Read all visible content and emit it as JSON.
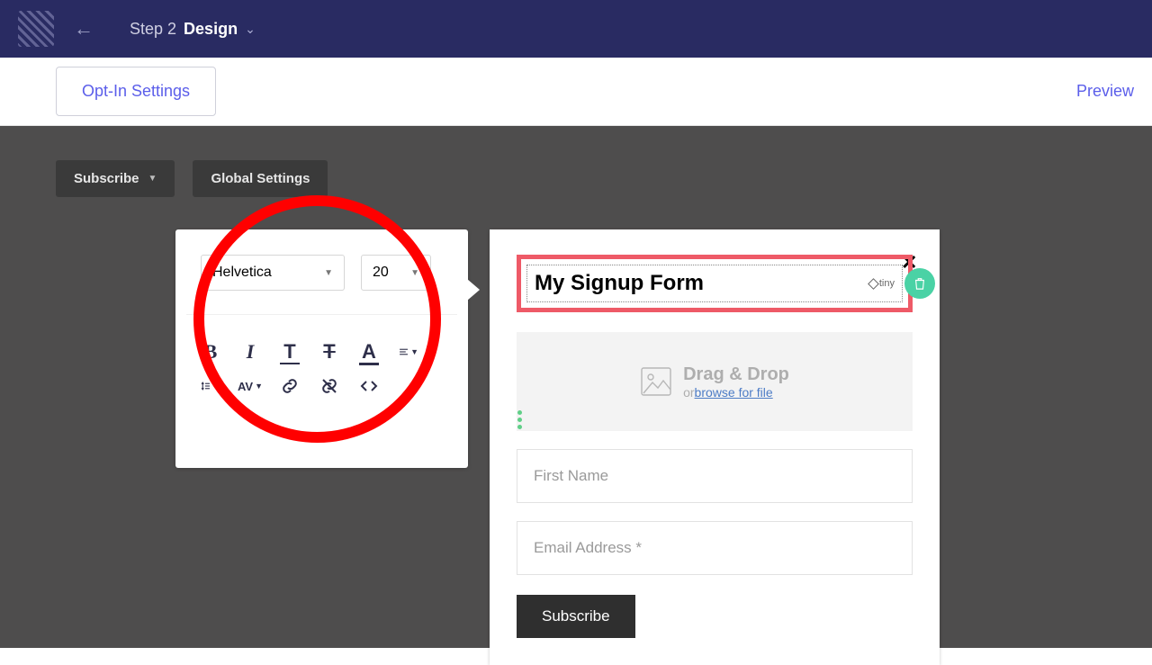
{
  "header": {
    "step_prefix": "Step 2",
    "step_name": "Design"
  },
  "subnav": {
    "optin_label": "Opt-In Settings",
    "preview_label": "Preview"
  },
  "tabs": {
    "subscribe": "Subscribe",
    "global": "Global Settings"
  },
  "toolbar": {
    "font": "Helvetica",
    "size": "20"
  },
  "form": {
    "title": "My Signup Form",
    "tiny": "tiny",
    "drop_title": "Drag & Drop",
    "drop_or": "or",
    "drop_browse": "browse for file",
    "first_name_ph": "First Name",
    "email_ph": "Email Address *",
    "submit": "Subscribe"
  }
}
